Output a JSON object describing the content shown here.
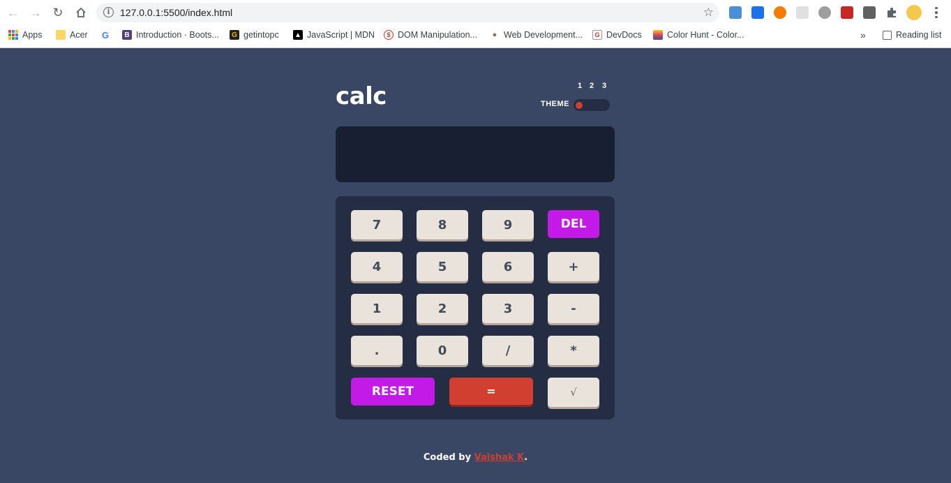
{
  "browser": {
    "url": "127.0.0.1:5500/index.html",
    "bookmarks": [
      {
        "label": "Apps",
        "icon": "apps-grid-icon"
      },
      {
        "label": "Acer",
        "icon": "folder-icon"
      },
      {
        "label": "",
        "icon": "google-icon"
      },
      {
        "label": "Introduction · Boots...",
        "icon": "bootstrap-icon"
      },
      {
        "label": "getintopc",
        "icon": "getintopc-icon"
      },
      {
        "label": "JavaScript | MDN",
        "icon": "mdn-icon"
      },
      {
        "label": "DOM Manipulation...",
        "icon": "dom-icon"
      },
      {
        "label": "Web Development...",
        "icon": "web-dev-icon"
      },
      {
        "label": "DevDocs",
        "icon": "devdocs-icon"
      },
      {
        "label": "Color Hunt - Color...",
        "icon": "color-hunt-icon"
      }
    ],
    "overflow": "»",
    "reading_list": "Reading list"
  },
  "calculator": {
    "title": "calc",
    "theme_label": "THEME",
    "theme_options": [
      "1",
      "2",
      "3"
    ],
    "selected_theme": 1,
    "display_value": "",
    "keys": {
      "row1": [
        "7",
        "8",
        "9",
        "DEL"
      ],
      "row2": [
        "4",
        "5",
        "6",
        "+"
      ],
      "row3": [
        "1",
        "2",
        "3",
        "-"
      ],
      "row4": [
        ".",
        "0",
        "/",
        "*"
      ],
      "row5": [
        "RESET",
        "=",
        "√"
      ]
    }
  },
  "footer": {
    "prefix": "Coded by",
    "author": "Vaishak K",
    "suffix": "."
  },
  "colors": {
    "background": "#3a4764",
    "keypad": "#242d44",
    "screen": "#181f33",
    "key": "#eae3dc",
    "accent_purple": "#c31ae8",
    "accent_red": "#d03f2f"
  }
}
